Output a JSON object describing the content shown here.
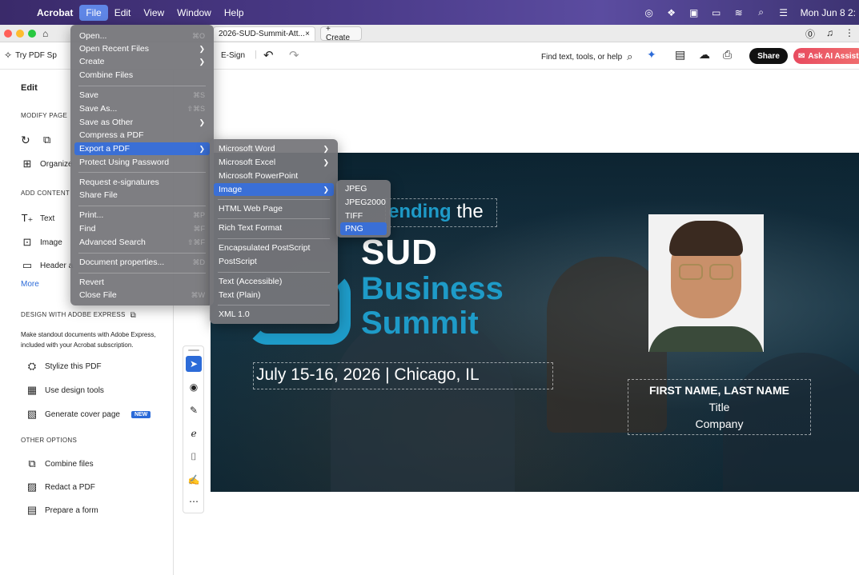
{
  "menubar": {
    "app": "Acrobat",
    "items": [
      "File",
      "Edit",
      "View",
      "Window",
      "Help"
    ],
    "clock": "Mon Jun 8 2:"
  },
  "tabs": {
    "doc_title": "2026-SUD-Summit-Att...",
    "close": "×",
    "create": "+ Create"
  },
  "toolbar": {
    "try_label": "Try PDF Sp",
    "esign": "E-Sign",
    "find_tools": "Find text, tools, or help",
    "share": "Share",
    "ai_assistant": "Ask AI Assist"
  },
  "left_panel": {
    "title": "Edit",
    "modify_heading": "MODIFY PAGE",
    "organize": "Organize",
    "add_content_heading": "ADD CONTENT",
    "text": "Text",
    "image": "Image",
    "header": "Header a",
    "more": "More",
    "design_heading": "DESIGN WITH ADOBE EXPRESS",
    "design_desc_1": "Make standout documents with Adobe Express,",
    "design_desc_2": "included with your Acrobat subscription.",
    "stylize": "Stylize this PDF",
    "design_tools": "Use design tools",
    "cover_page": "Generate cover page",
    "new_badge": "NEW",
    "other_heading": "OTHER OPTIONS",
    "combine": "Combine files",
    "redact": "Redact a PDF",
    "prepare": "Prepare a form"
  },
  "document": {
    "attending_bold": "ending",
    "attending_rest": " the",
    "sud": "SUD",
    "business": "Business",
    "summit": "Summit",
    "date": "July 15-16, 2026 | Chicago, IL",
    "name": "FIRST NAME, LAST NAME",
    "title": "Title",
    "company": "Company"
  },
  "file_menu": {
    "open": "Open...",
    "open_sc": "⌘O",
    "open_recent": "Open Recent Files",
    "create": "Create",
    "combine": "Combine Files",
    "save": "Save",
    "save_sc": "⌘S",
    "save_as": "Save As...",
    "save_as_sc": "⇧⌘S",
    "save_other": "Save as Other",
    "compress": "Compress a PDF",
    "export": "Export a PDF",
    "protect": "Protect Using Password",
    "request_sign": "Request e-signatures",
    "share": "Share File",
    "print": "Print...",
    "print_sc": "⌘P",
    "find": "Find",
    "find_sc": "⌘F",
    "adv_search": "Advanced Search",
    "adv_search_sc": "⇧⌘F",
    "doc_props": "Document properties...",
    "doc_props_sc": "⌘D",
    "revert": "Revert",
    "close": "Close File",
    "close_sc": "⌘W"
  },
  "export_menu": {
    "word": "Microsoft Word",
    "excel": "Microsoft Excel",
    "ppt": "Microsoft PowerPoint",
    "image": "Image",
    "html": "HTML Web Page",
    "rtf": "Rich Text Format",
    "eps": "Encapsulated PostScript",
    "ps": "PostScript",
    "text_acc": "Text (Accessible)",
    "text_plain": "Text (Plain)",
    "xml": "XML 1.0"
  },
  "image_menu": {
    "jpeg": "JPEG",
    "jpeg2000": "JPEG2000",
    "tiff": "TIFF",
    "png": "PNG"
  },
  "colors": {
    "highlight": "#3a6fd6",
    "accent_teal": "#1e9bc8",
    "share_bg": "#111111",
    "ai_bg": "#e84b5f"
  }
}
